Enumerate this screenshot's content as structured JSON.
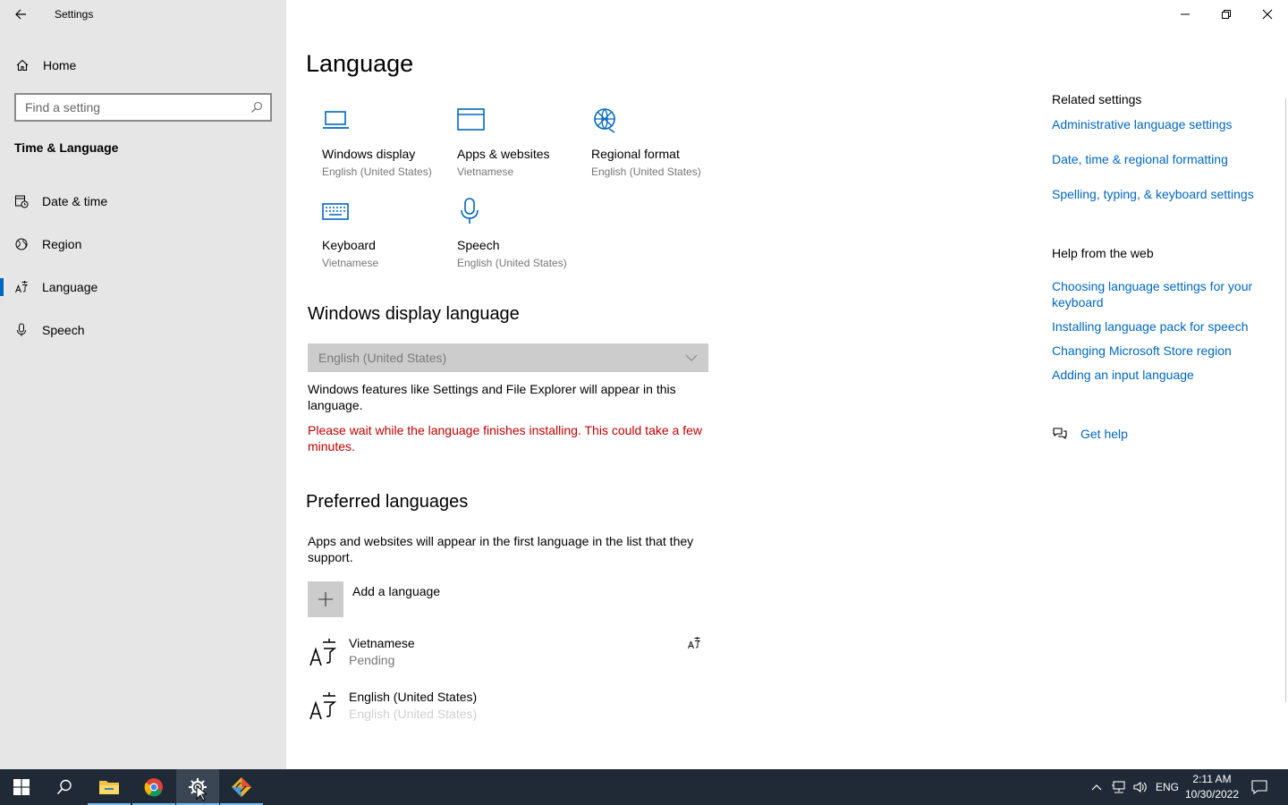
{
  "window": {
    "title": "Settings"
  },
  "sidebar": {
    "home_label": "Home",
    "search_placeholder": "Find a setting",
    "section_title": "Time & Language",
    "items": [
      {
        "label": "Date & time",
        "icon": "calendar-clock-icon"
      },
      {
        "label": "Region",
        "icon": "globe-icon"
      },
      {
        "label": "Language",
        "icon": "language-icon",
        "selected": true
      },
      {
        "label": "Speech",
        "icon": "microphone-icon"
      }
    ]
  },
  "main": {
    "title": "Language",
    "tiles": [
      {
        "title": "Windows display",
        "subtitle": "English (United States)",
        "icon": "laptop-icon"
      },
      {
        "title": "Apps & websites",
        "subtitle": "Vietnamese",
        "icon": "browser-window-icon"
      },
      {
        "title": "Regional format",
        "subtitle": "English (United States)",
        "icon": "regional-format-icon"
      },
      {
        "title": "Keyboard",
        "subtitle": "Vietnamese",
        "icon": "keyboard-icon"
      },
      {
        "title": "Speech",
        "subtitle": "English (United States)",
        "icon": "microphone-icon"
      }
    ],
    "display_language": {
      "heading": "Windows display language",
      "selected": "English (United States)",
      "description": "Windows features like Settings and File Explorer will appear in this language.",
      "warning": "Please wait while the language finishes installing. This could take a few minutes."
    },
    "preferred": {
      "heading": "Preferred languages",
      "description": "Apps and websites will appear in the first language in the list that they support.",
      "add_label": "Add a language",
      "languages": [
        {
          "name": "Vietnamese",
          "status": "Pending"
        },
        {
          "name": "English (United States)",
          "status": "English (United States)"
        }
      ]
    }
  },
  "related": {
    "heading": "Related settings",
    "links": [
      "Administrative language settings",
      "Date, time & regional formatting",
      "Spelling, typing, & keyboard settings"
    ],
    "help_heading": "Help from the web",
    "help_links": [
      "Choosing language settings for your keyboard",
      "Installing language pack for speech",
      "Changing Microsoft Store region",
      "Adding an input language"
    ],
    "get_help": "Get help"
  },
  "taskbar": {
    "input_indicator": "ENG",
    "time": "2:11 AM",
    "date": "10/30/2022",
    "apps": [
      "file-explorer-icon",
      "chrome-icon",
      "settings-gear-icon",
      "git-app-icon"
    ]
  },
  "colors": {
    "accent": "#0067c0",
    "sidebar_bg": "#e6e6e6",
    "warning": "#c00000",
    "taskbar_bg": "#1f2a36"
  }
}
